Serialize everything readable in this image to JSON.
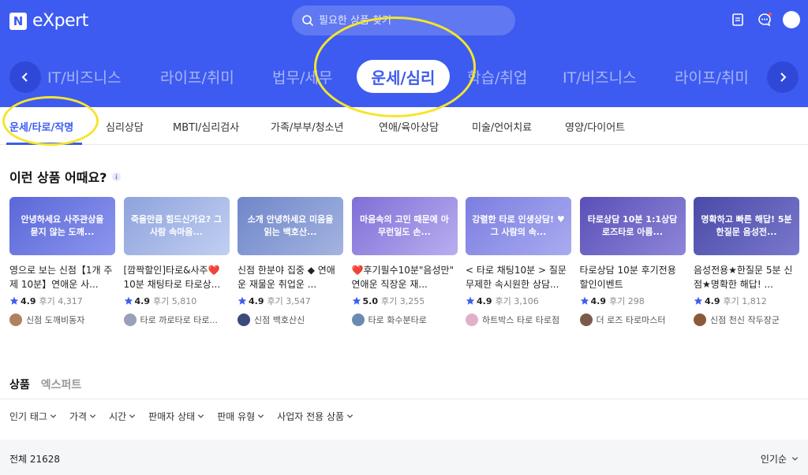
{
  "header": {
    "logo_mark": "N",
    "logo_text": "eXpert",
    "search_placeholder": "필요한 상품 찾기"
  },
  "categories": [
    {
      "label": "IT/비즈니스"
    },
    {
      "label": "라이프/취미"
    },
    {
      "label": "법무/세무"
    },
    {
      "label": "운세/심리"
    },
    {
      "label": "학습/취업"
    },
    {
      "label": "IT/비즈니스"
    },
    {
      "label": "라이프/취미"
    }
  ],
  "subcategories": [
    {
      "label": "운세/타로/작명"
    },
    {
      "label": "심리상담"
    },
    {
      "label": "MBTI/심리검사"
    },
    {
      "label": "가족/부부/청소년"
    },
    {
      "label": "연애/육아상담"
    },
    {
      "label": "미술/언어치료"
    },
    {
      "label": "영양/다이어트"
    }
  ],
  "recommend": {
    "title": "이런 상품 어때요?",
    "items": [
      {
        "thumb": "안녕하세요 사주관상을 묻지 않는 도깨...",
        "title": "영으로 보는 신점【1개 주제 10분】연애운 사...",
        "rating": "4.9",
        "reviews": "후기 4,317",
        "seller": "신점 도깨비동자",
        "c1": "#5b67d8",
        "c2": "#8c96ee",
        "av": "#b08060"
      },
      {
        "thumb": "죽을만큼 힘드신가요? 그사람 속마음...",
        "title": "[깜짝할인]타로&사주❤️10분 채팅타로 타로상...",
        "rating": "4.9",
        "reviews": "후기 5,810",
        "seller": "타로 까로타로 타로...",
        "c1": "#8ea3dd",
        "c2": "#c2cff1",
        "av": "#9aa0b8"
      },
      {
        "thumb": "소개 안녕하세요 미음을 읽는 백호산...",
        "title": "신점 한분야 집중 ◆ 연애운 재물운 취업운 ...",
        "rating": "4.9",
        "reviews": "후기 3,547",
        "seller": "신점 백호산신",
        "c1": "#6f86c9",
        "c2": "#a4b4e0",
        "av": "#3a4a7a"
      },
      {
        "thumb": "마음속의 고민 때문에 아무런일도 손...",
        "title": "❤️후기필수10분\"음성만\" 연애운 직장운 재...",
        "rating": "5.0",
        "reviews": "후기 3,255",
        "seller": "타로 화수분타로",
        "c1": "#7f6fd6",
        "c2": "#b9aef0",
        "av": "#6a8ab0"
      },
      {
        "thumb": "강렬한 타로 인생상담! ♥ 그 사람의 속...",
        "title": "< 타로 채팅10분 > 질문무제한 속시원한 상담...",
        "rating": "4.9",
        "reviews": "후기 3,106",
        "seller": "하트박스 타로 타로점",
        "c1": "#7c7ee0",
        "c2": "#a9abf0",
        "av": "#e0b0c8"
      },
      {
        "thumb": "타로상담 10분 1:1상담 로즈타로 아름...",
        "title": "타로상담 10분 후기전용 할인이벤트",
        "rating": "4.9",
        "reviews": "후기 298",
        "seller": "더 로즈 타로마스터",
        "c1": "#5a4fb8",
        "c2": "#8e86d8",
        "av": "#7a5a4a"
      },
      {
        "thumb": "명확하고 빠른 해답! 5분 한질문 음성전...",
        "title": "음성전용★한질문 5분 신점★명확한 해답! ...",
        "rating": "4.9",
        "reviews": "후기 1,812",
        "seller": "신점 천신 작두장군",
        "c1": "#4a4aa8",
        "c2": "#7a78cc",
        "av": "#8a5a3a"
      }
    ]
  },
  "list_tabs": {
    "products": "상품",
    "experts": "엑스퍼트"
  },
  "filters": [
    {
      "label": "인기 태그"
    },
    {
      "label": "가격"
    },
    {
      "label": "시간"
    },
    {
      "label": "판매자 상태"
    },
    {
      "label": "판매 유형"
    },
    {
      "label": "사업자 전용 상품"
    }
  ],
  "total": "전체 21628",
  "sort": "인기순",
  "colors": {
    "brand": "#3d5bf0",
    "highlight": "#f5e52c"
  }
}
